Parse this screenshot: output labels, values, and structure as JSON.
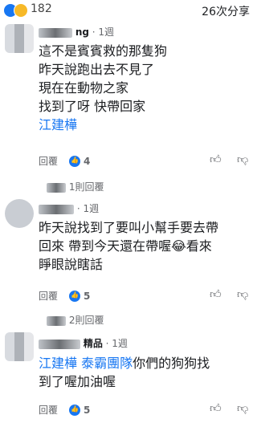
{
  "top": {
    "reaction_count": "182",
    "share_count": "26次分享"
  },
  "comments": [
    {
      "author": "ng",
      "time": "· 1週",
      "lines": [
        "這不是賓賓救的那隻狗",
        "昨天說跑出去不見了",
        "現在在動物之家",
        "找到了呀 快帶回家"
      ],
      "mention": "江建樺",
      "reply_label": "回覆",
      "like_count": "4",
      "replies_label": "1則回覆"
    },
    {
      "author": "",
      "time": "· 1週",
      "lines": [
        "昨天說找到了要叫小幫手要去帶",
        "回來  帶到今天還在帶喔😂看來",
        "睜眼說瞎話"
      ],
      "reply_label": "回覆",
      "like_count": "5",
      "replies_label": "2則回覆"
    },
    {
      "author": "精品",
      "time": "· 1週",
      "mentions": [
        "江建樺",
        "泰霸團隊"
      ],
      "text_line1": "你們的狗狗找",
      "text_line2": "到了喔加油喔",
      "reply_label": "回覆",
      "like_count": "5"
    }
  ]
}
